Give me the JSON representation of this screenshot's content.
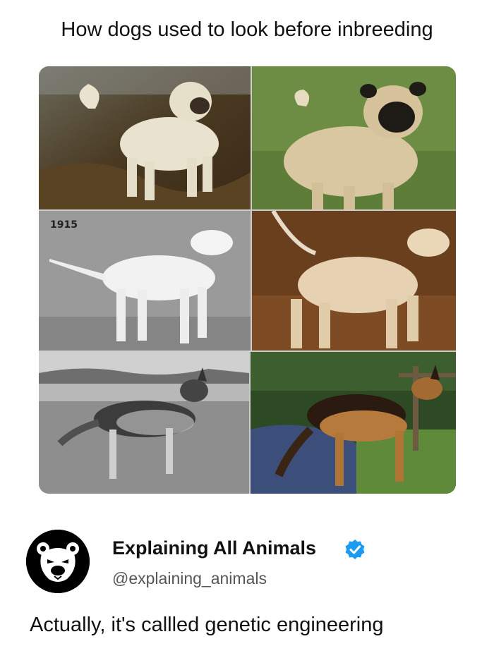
{
  "title": "How dogs used to look before inbreeding",
  "collage": {
    "photos": [
      {
        "label": "",
        "breed": "pug",
        "era": "old painting"
      },
      {
        "label": "",
        "breed": "pug",
        "era": "modern"
      },
      {
        "label": "1915",
        "breed": "bull terrier",
        "era": "old photo"
      },
      {
        "label": "",
        "breed": "bull terrier",
        "era": "modern"
      },
      {
        "label": "",
        "breed": "german shepherd",
        "era": "old photo"
      },
      {
        "label": "",
        "breed": "german shepherd",
        "era": "modern"
      }
    ]
  },
  "profile": {
    "name": "Explaining All Animals",
    "handle": "@explaining_animals",
    "avatar_icon": "bear-face-icon",
    "verified_icon": "verified-badge-icon",
    "verified_color": "#1d9bf0"
  },
  "caption": "Actually, it's callled genetic engineering"
}
